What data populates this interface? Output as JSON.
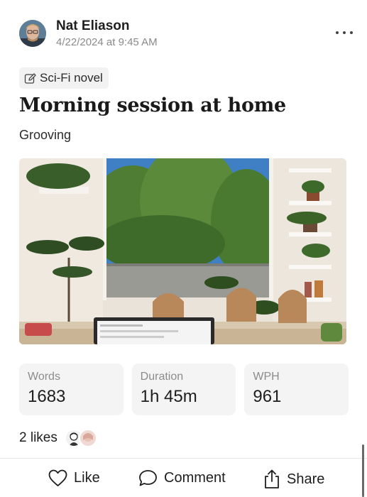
{
  "post": {
    "author": "Nat Eliason",
    "timestamp": "4/22/2024 at 9:45 AM",
    "tag": {
      "label": "Sci-Fi novel",
      "icon": "pencil-icon"
    },
    "title": "Morning session at home",
    "subtitle": "Grooving"
  },
  "stats": [
    {
      "label": "Words",
      "value": "1683"
    },
    {
      "label": "Duration",
      "value": "1h 45m"
    },
    {
      "label": "WPH",
      "value": "961"
    }
  ],
  "likes": {
    "text": "2 likes"
  },
  "actions": {
    "like": "Like",
    "comment": "Comment",
    "share": "Share"
  },
  "colors": {
    "card_bg": "#f4f4f4",
    "muted_text": "#8c8c8c",
    "tag_bg": "#f2f2f2"
  }
}
